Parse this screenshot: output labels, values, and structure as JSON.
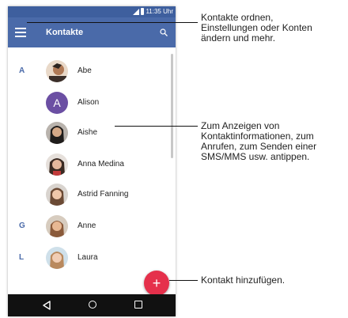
{
  "status_bar": {
    "time": "11:35 Uhr"
  },
  "app_bar": {
    "title": "Kontakte"
  },
  "contacts": [
    {
      "letter": "A",
      "name": "Abe"
    },
    {
      "letter": "",
      "name": "Alison",
      "initial": "A"
    },
    {
      "letter": "",
      "name": "Aishe"
    },
    {
      "letter": "",
      "name": "Anna Medina"
    },
    {
      "letter": "",
      "name": "Astrid Fanning"
    },
    {
      "letter": "G",
      "name": "Anne"
    },
    {
      "letter": "L",
      "name": "Laura"
    }
  ],
  "fab": {
    "symbol": "+"
  },
  "callouts": {
    "menu": [
      "Kontakte ordnen,",
      "Einstellungen oder Konten",
      "ändern und mehr."
    ],
    "contact": [
      "Zum Anzeigen von",
      "Kontaktinformationen, zum",
      "Anrufen, zum Senden einer",
      "SMS/MMS usw. antippen."
    ],
    "add": [
      "Kontakt hinzufügen."
    ]
  },
  "colors": {
    "app_bar": "#4a6aa9",
    "status_bar": "#3e5f9e",
    "letter": "#4a6aa9",
    "fab": "#e5304b",
    "initial_avatar": "#6b4fa3"
  },
  "icons": [
    "menu-icon",
    "search-icon",
    "back-icon",
    "home-icon",
    "recent-apps-icon",
    "add-icon"
  ]
}
